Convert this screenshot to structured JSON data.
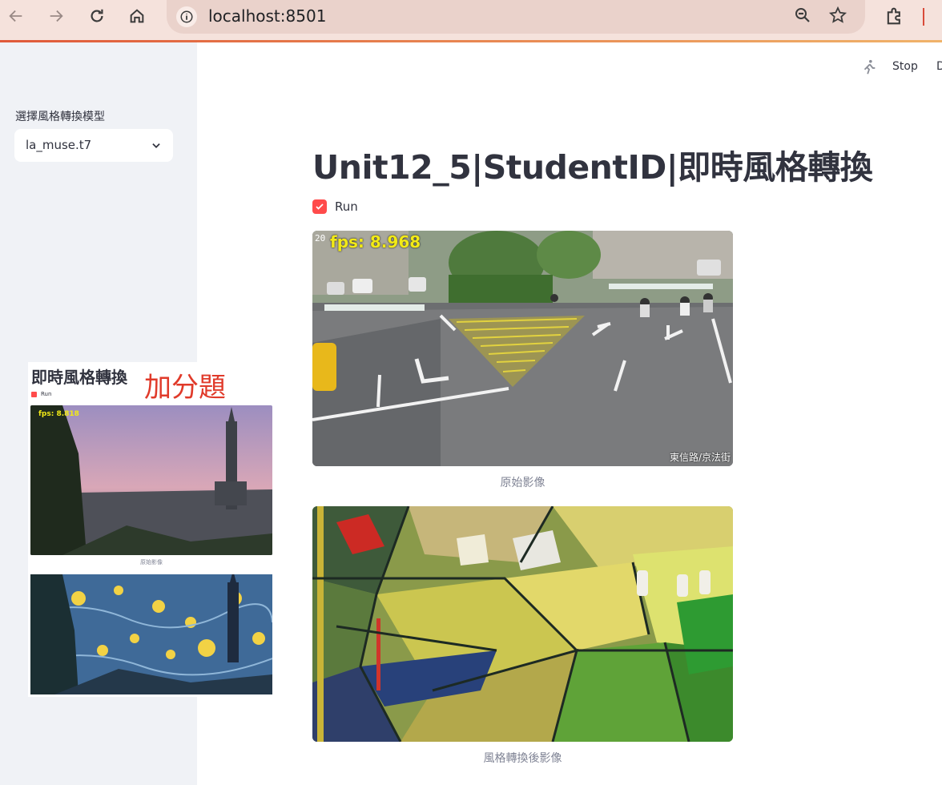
{
  "browser": {
    "url": "localhost:8501",
    "back_icon": "arrow-left-icon",
    "forward_icon": "arrow-right-icon",
    "reload_icon": "reload-icon",
    "home_icon": "home-icon"
  },
  "sidebar": {
    "select_label": "選擇風格轉換模型",
    "select_value": "la_muse.t7"
  },
  "toolbar": {
    "stop_label": "Stop",
    "deploy_label": "D"
  },
  "main": {
    "title": "Unit12_5|StudentID|即時風格轉換",
    "run_label": "Run",
    "run_checked": true,
    "video": {
      "fps_text": "fps: 8.968",
      "timestamp": "20",
      "location_text": "東信路/京法街"
    },
    "caption_original": "原始影像",
    "caption_styled": "風格轉換後影像"
  },
  "bonus_panel": {
    "title": "即時風格轉換",
    "tag": "加分題",
    "run_label": "Run",
    "fps_text": "fps: 8.818",
    "caption": "原始影像"
  },
  "colors": {
    "accent": "#ff4b4b",
    "sidebar_bg": "#f0f2f6",
    "chrome_bg": "#f5e2dc",
    "bonus_tag": "#e03a2a"
  }
}
